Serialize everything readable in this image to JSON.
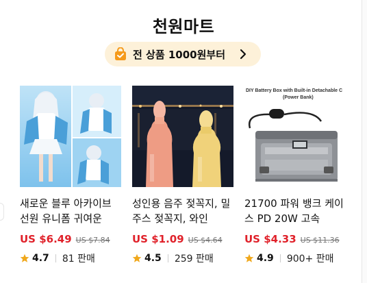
{
  "section": {
    "title": "천원마트",
    "banner_text": "전 상품 1000원부터"
  },
  "icons": {
    "banner": "shopping-bag-icon",
    "banner_arrow": "chevron-right-icon",
    "rating": "star-icon"
  },
  "colors": {
    "price": "#e0212a",
    "banner_bg": "#fdf1d9",
    "banner_icon": "#f59a1b",
    "star": "#f0a81c"
  },
  "products": [
    {
      "name": "새로운 블루 아카이브 선원 유니폼 귀여운",
      "price": "US $6.49",
      "original_price": "US $7.84",
      "rating": "4.7",
      "sold": "81 판매"
    },
    {
      "name": "성인용 음주 젖꼭지, 밀 주스 젖꼭지, 와인",
      "price": "US $1.09",
      "original_price": "US $4.64",
      "rating": "4.5",
      "sold": "259 판매"
    },
    {
      "name": "21700 파워 뱅크 케이스 PD 20W 고속",
      "price": "US $4.33",
      "original_price": "US $11.36",
      "rating": "4.9",
      "sold": "900+ 판매",
      "image_caption": "DIY Battery Box with Built-in Detachable C",
      "image_caption_sub": "(Power Bank)"
    }
  ]
}
